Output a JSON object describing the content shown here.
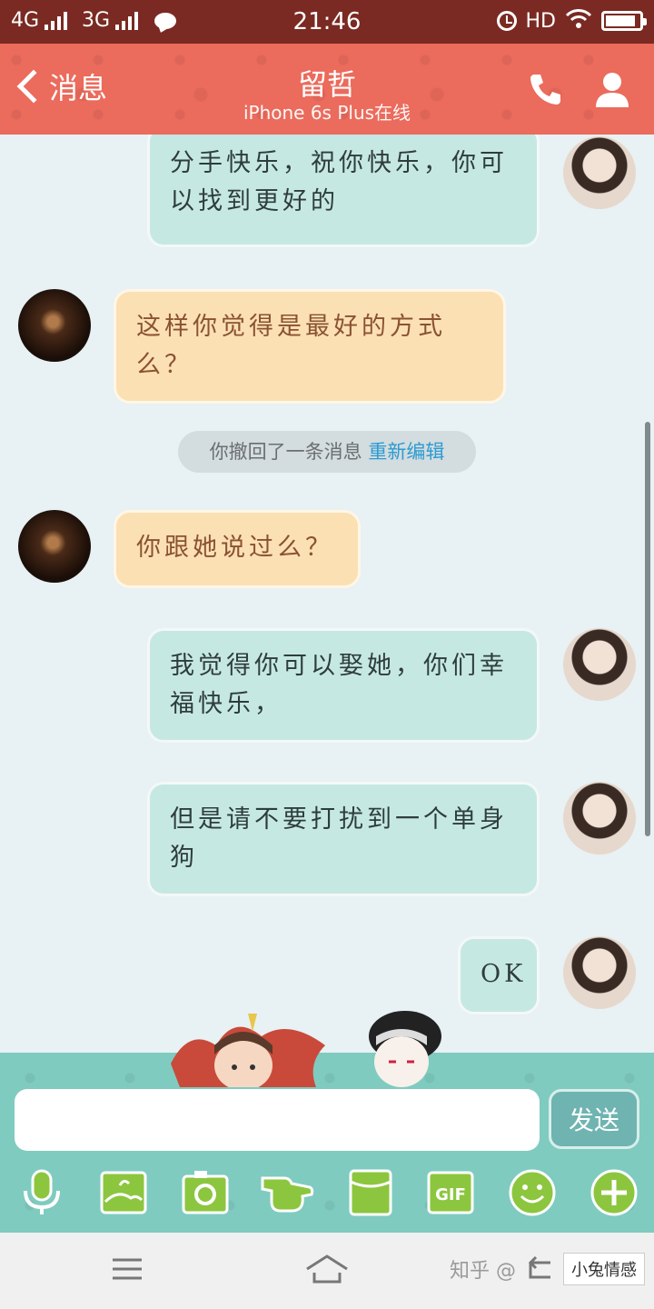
{
  "status_bar": {
    "network1": "4G",
    "network2": "3G",
    "time": "21:46",
    "hd": "HD",
    "battery_level": 0.9
  },
  "header": {
    "back_label": "消息",
    "title": "留哲",
    "subtitle": "iPhone 6s Plus在线",
    "icons": [
      "phone-icon",
      "user-icon"
    ],
    "color": "#eb6b5c"
  },
  "messages": [
    {
      "side": "right",
      "text": "分手快乐，祝你快乐，你可以找到更好的"
    },
    {
      "side": "left",
      "text": "这样你觉得是最好的方式么？"
    },
    {
      "side": "right",
      "text": "我觉得你可以娶她，你们幸福快乐，"
    },
    {
      "side": "left",
      "text": "你跟她说过么？"
    },
    {
      "side": "right",
      "text": "但是请不要打扰到一个单身狗"
    },
    {
      "side": "right",
      "text": "OK"
    }
  ],
  "recall_notice": {
    "text": "你撤回了一条消息",
    "link": "重新编辑"
  },
  "composer": {
    "placeholder": "",
    "send_label": "发送",
    "tools": [
      "microphone-icon",
      "image-icon",
      "camera-icon",
      "poke-icon",
      "folder-icon",
      "gif-icon",
      "emoji-icon",
      "plus-icon"
    ],
    "gif_label": "GIF"
  },
  "nav_bar": {
    "icons": [
      "menu-icon",
      "home-icon",
      "back-icon"
    ],
    "watermark_text": "知乎 @",
    "watermark_logo": "小兔情感"
  }
}
